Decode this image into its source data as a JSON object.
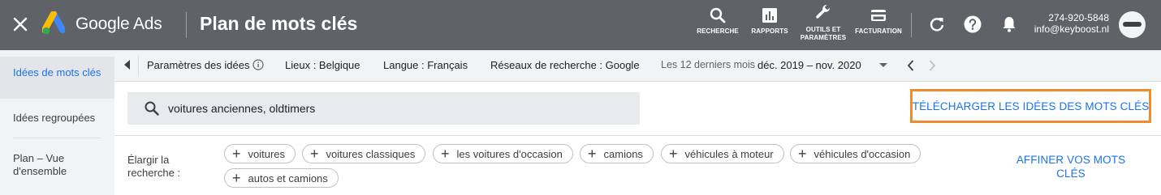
{
  "header": {
    "close_icon": "close-icon",
    "logo_icon": "google-ads-logo",
    "brand": "Google Ads",
    "page_title": "Plan de mots clés",
    "tools": [
      {
        "icon": "search-icon",
        "label": "RECHERCHE"
      },
      {
        "icon": "bar-chart-icon",
        "label": "RAPPORTS"
      },
      {
        "icon": "wrench-icon",
        "label_line1": "OUTILS ET",
        "label_line2": "PARAMÈTRES"
      },
      {
        "icon": "credit-card-icon",
        "label": "FACTURATION"
      }
    ],
    "account_id": "274-920-5848",
    "account_email": "info@keyboost.nl"
  },
  "sidebar": {
    "items": [
      {
        "label": "Idées de mots clés",
        "active": true
      },
      {
        "label": "Idées regroupées",
        "active": false
      },
      {
        "label": "Plan – Vue d'ensemble",
        "active": false
      }
    ]
  },
  "filterbar": {
    "params_label": "Paramètres des idées",
    "location": "Lieux : Belgique",
    "language": "Langue : Français",
    "network": "Réseaux de recherche : Google",
    "period_label": "Les 12 derniers mois",
    "period_value": "déc. 2019 – nov. 2020"
  },
  "search": {
    "value": "voitures anciennes, oldtimers"
  },
  "download_button": "TÉLÉCHARGER LES IDÉES DES MOTS CLÉS",
  "broaden": {
    "label": "Élargir la recherche :",
    "chips": [
      "voitures",
      "voitures classiques",
      "les voitures d'occasion",
      "camions",
      "véhicules à moteur",
      "véhicules d'occasion",
      "autos et camions"
    ]
  },
  "refine_button": "AFFINER VOS MOTS CLÉS",
  "colors": {
    "topbar": "#5f6368",
    "accent": "#1a73e8",
    "highlight_border": "#f28a2e",
    "sidebar_bg": "#f1f3f4"
  }
}
